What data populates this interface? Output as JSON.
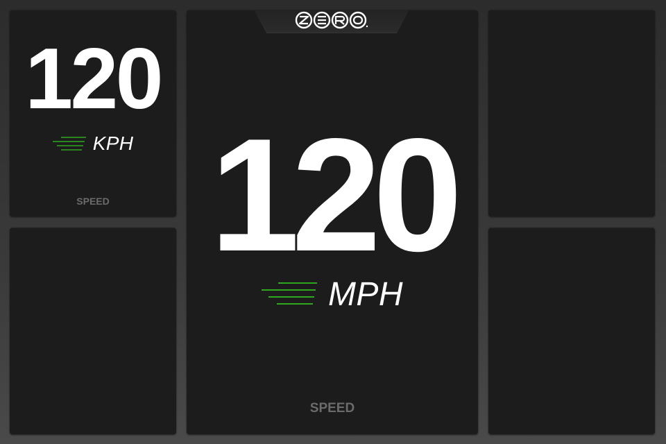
{
  "brand": {
    "logo_icon": "zero-logo",
    "logo_text": "ZERO"
  },
  "colors": {
    "accent_green": "#2ea81e",
    "value_white": "#ffffff",
    "label_gray": "#6b6b6b",
    "panel_bg": "#1c1c1c"
  },
  "panels": {
    "top_left": {
      "value": "120",
      "unit": "KPH",
      "label": "SPEED"
    },
    "center": {
      "value": "120",
      "unit": "MPH",
      "label": "SPEED"
    }
  }
}
